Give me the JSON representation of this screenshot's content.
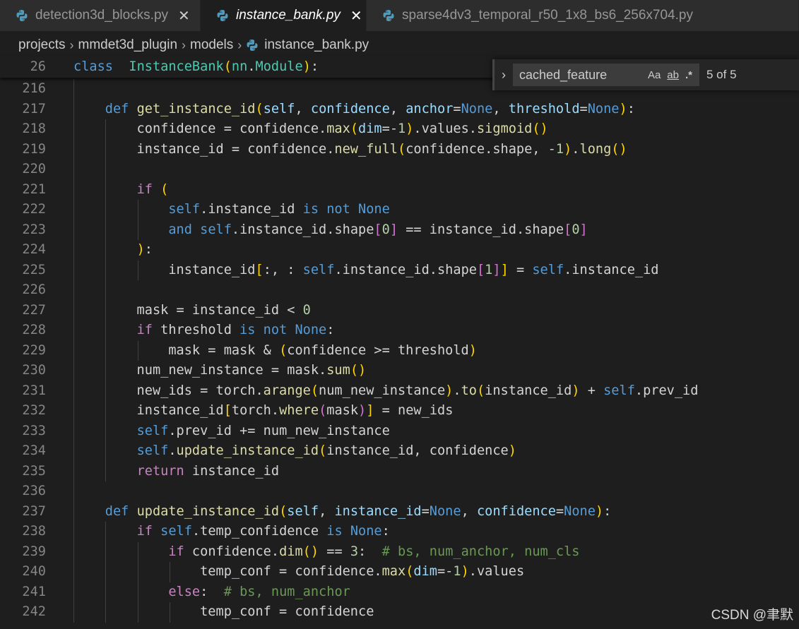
{
  "tabs": [
    {
      "label": "detection3d_blocks.py",
      "active": false,
      "close": "✕"
    },
    {
      "label": "instance_bank.py",
      "active": true,
      "close": "✕"
    },
    {
      "label": "sparse4dv3_temporal_r50_1x8_bs6_256x704.py",
      "active": false,
      "close": ""
    }
  ],
  "breadcrumb": {
    "items": [
      "projects",
      "mmdet3d_plugin",
      "models"
    ],
    "file": "instance_bank.py",
    "separator": "›"
  },
  "find": {
    "toggle": "›",
    "value": "cached_feature",
    "match_case": "Aa",
    "whole_word": "ab",
    "regex": ".*",
    "count": "5 of 5"
  },
  "colors": {
    "background": "#1e1e1e",
    "keyword": "#569cd6",
    "control": "#c586c0",
    "function": "#dcdcaa",
    "class": "#4ec9b0",
    "param": "#9cdcfe",
    "number": "#b5cea8",
    "comment": "#6a9955"
  },
  "sticky_line": {
    "num": "26",
    "tokens": [
      [
        "kw",
        "class"
      ],
      [
        "",
        "  "
      ],
      [
        "cl",
        "InstanceBank"
      ],
      [
        "b1",
        "("
      ],
      [
        "cl",
        "nn"
      ],
      [
        "",
        ".",
        ""
      ],
      [
        "cl",
        "Module"
      ],
      [
        "b1",
        ")"
      ],
      [
        "",
        ":"
      ]
    ]
  },
  "code_lines": [
    {
      "num": "216",
      "guides": [
        0
      ],
      "tokens": []
    },
    {
      "num": "217",
      "guides": [
        0
      ],
      "tokens": [
        [
          "",
          "    "
        ],
        [
          "kw",
          "def"
        ],
        [
          "",
          " "
        ],
        [
          "fn",
          "get_instance_id"
        ],
        [
          "b1",
          "("
        ],
        [
          "pm",
          "self"
        ],
        [
          "",
          ", "
        ],
        [
          "pm",
          "confidence"
        ],
        [
          "",
          ", "
        ],
        [
          "pm",
          "anchor"
        ],
        [
          "",
          "="
        ],
        [
          "kw",
          "None"
        ],
        [
          "",
          ", "
        ],
        [
          "pm",
          "threshold"
        ],
        [
          "",
          "="
        ],
        [
          "kw",
          "None"
        ],
        [
          "b1",
          ")"
        ],
        [
          "",
          ":"
        ]
      ]
    },
    {
      "num": "218",
      "guides": [
        0,
        1
      ],
      "tokens": [
        [
          "",
          "        confidence = confidence."
        ],
        [
          "fn",
          "max"
        ],
        [
          "b1",
          "("
        ],
        [
          "pm",
          "dim"
        ],
        [
          "",
          "=-"
        ],
        [
          "num",
          "1"
        ],
        [
          "b1",
          ")"
        ],
        [
          "",
          ".values."
        ],
        [
          "fn",
          "sigmoid"
        ],
        [
          "b1",
          "()"
        ]
      ]
    },
    {
      "num": "219",
      "guides": [
        0,
        1
      ],
      "tokens": [
        [
          "",
          "        instance_id = confidence."
        ],
        [
          "fn",
          "new_full"
        ],
        [
          "b1",
          "("
        ],
        [
          "",
          "confidence.shape, -"
        ],
        [
          "num",
          "1"
        ],
        [
          "b1",
          ")"
        ],
        [
          "",
          "."
        ],
        [
          "fn",
          "long"
        ],
        [
          "b1",
          "()"
        ]
      ]
    },
    {
      "num": "220",
      "guides": [
        0,
        1
      ],
      "tokens": []
    },
    {
      "num": "221",
      "guides": [
        0,
        1
      ],
      "tokens": [
        [
          "",
          "        "
        ],
        [
          "ck",
          "if"
        ],
        [
          "",
          " "
        ],
        [
          "b1",
          "("
        ]
      ]
    },
    {
      "num": "222",
      "guides": [
        0,
        1,
        2
      ],
      "tokens": [
        [
          "",
          "            "
        ],
        [
          "kw",
          "self"
        ],
        [
          "",
          ".instance_id "
        ],
        [
          "kw",
          "is not None"
        ]
      ]
    },
    {
      "num": "223",
      "guides": [
        0,
        1,
        2
      ],
      "tokens": [
        [
          "",
          "            "
        ],
        [
          "kw",
          "and"
        ],
        [
          "",
          " "
        ],
        [
          "kw",
          "self"
        ],
        [
          "",
          ".instance_id.shape"
        ],
        [
          "b2",
          "["
        ],
        [
          "num",
          "0"
        ],
        [
          "b2",
          "]"
        ],
        [
          "",
          " == instance_id.shape"
        ],
        [
          "b2",
          "["
        ],
        [
          "num",
          "0"
        ],
        [
          "b2",
          "]"
        ]
      ]
    },
    {
      "num": "224",
      "guides": [
        0,
        1
      ],
      "tokens": [
        [
          "",
          "        "
        ],
        [
          "b1",
          ")"
        ],
        [
          "",
          ":"
        ]
      ]
    },
    {
      "num": "225",
      "guides": [
        0,
        1,
        2
      ],
      "tokens": [
        [
          "",
          "            instance_id"
        ],
        [
          "b1",
          "["
        ],
        [
          "",
          ":, : "
        ],
        [
          "kw",
          "self"
        ],
        [
          "",
          ".instance_id.shape"
        ],
        [
          "b2",
          "["
        ],
        [
          "num",
          "1"
        ],
        [
          "b2",
          "]"
        ],
        [
          "b1",
          "]"
        ],
        [
          "",
          " = "
        ],
        [
          "kw",
          "self"
        ],
        [
          "",
          ".instance_id"
        ]
      ]
    },
    {
      "num": "226",
      "guides": [
        0,
        1
      ],
      "tokens": []
    },
    {
      "num": "227",
      "guides": [
        0,
        1
      ],
      "tokens": [
        [
          "",
          "        mask = instance_id < "
        ],
        [
          "num",
          "0"
        ]
      ]
    },
    {
      "num": "228",
      "guides": [
        0,
        1
      ],
      "tokens": [
        [
          "",
          "        "
        ],
        [
          "ck",
          "if"
        ],
        [
          "",
          " threshold "
        ],
        [
          "kw",
          "is not None"
        ],
        [
          "",
          ":"
        ]
      ]
    },
    {
      "num": "229",
      "guides": [
        0,
        1,
        2
      ],
      "tokens": [
        [
          "",
          "            mask = mask & "
        ],
        [
          "b1",
          "("
        ],
        [
          "",
          "confidence >= threshold"
        ],
        [
          "b1",
          ")"
        ]
      ]
    },
    {
      "num": "230",
      "guides": [
        0,
        1
      ],
      "tokens": [
        [
          "",
          "        num_new_instance = mask."
        ],
        [
          "fn",
          "sum"
        ],
        [
          "b1",
          "()"
        ]
      ]
    },
    {
      "num": "231",
      "guides": [
        0,
        1
      ],
      "tokens": [
        [
          "",
          "        new_ids = torch."
        ],
        [
          "fn",
          "arange"
        ],
        [
          "b1",
          "("
        ],
        [
          "",
          "num_new_instance"
        ],
        [
          "b1",
          ")"
        ],
        [
          "",
          "."
        ],
        [
          "fn",
          "to"
        ],
        [
          "b1",
          "("
        ],
        [
          "",
          "instance_id"
        ],
        [
          "b1",
          ")"
        ],
        [
          "",
          " + "
        ],
        [
          "kw",
          "self"
        ],
        [
          "",
          ".prev_id"
        ]
      ]
    },
    {
      "num": "232",
      "guides": [
        0,
        1
      ],
      "tokens": [
        [
          "",
          "        instance_id"
        ],
        [
          "b1",
          "["
        ],
        [
          "",
          "torch."
        ],
        [
          "fn",
          "where"
        ],
        [
          "b2",
          "("
        ],
        [
          "",
          "mask"
        ],
        [
          "b2",
          ")"
        ],
        [
          "b1",
          "]"
        ],
        [
          "",
          " = new_ids"
        ]
      ]
    },
    {
      "num": "233",
      "guides": [
        0,
        1
      ],
      "tokens": [
        [
          "",
          "        "
        ],
        [
          "kw",
          "self"
        ],
        [
          "",
          ".prev_id += num_new_instance"
        ]
      ]
    },
    {
      "num": "234",
      "guides": [
        0,
        1
      ],
      "tokens": [
        [
          "",
          "        "
        ],
        [
          "kw",
          "self"
        ],
        [
          "",
          "."
        ],
        [
          "fn",
          "update_instance_id"
        ],
        [
          "b1",
          "("
        ],
        [
          "",
          "instance_id, confidence"
        ],
        [
          "b1",
          ")"
        ]
      ]
    },
    {
      "num": "235",
      "guides": [
        0,
        1
      ],
      "tokens": [
        [
          "",
          "        "
        ],
        [
          "ck",
          "return"
        ],
        [
          "",
          " instance_id"
        ]
      ]
    },
    {
      "num": "236",
      "guides": [
        0
      ],
      "tokens": []
    },
    {
      "num": "237",
      "guides": [
        0
      ],
      "tokens": [
        [
          "",
          "    "
        ],
        [
          "kw",
          "def"
        ],
        [
          "",
          " "
        ],
        [
          "fn",
          "update_instance_id"
        ],
        [
          "b1",
          "("
        ],
        [
          "pm",
          "self"
        ],
        [
          "",
          ", "
        ],
        [
          "pm",
          "instance_id"
        ],
        [
          "",
          "="
        ],
        [
          "kw",
          "None"
        ],
        [
          "",
          ", "
        ],
        [
          "pm",
          "confidence"
        ],
        [
          "",
          "="
        ],
        [
          "kw",
          "None"
        ],
        [
          "b1",
          ")"
        ],
        [
          "",
          ":"
        ]
      ]
    },
    {
      "num": "238",
      "guides": [
        0,
        1
      ],
      "tokens": [
        [
          "",
          "        "
        ],
        [
          "ck",
          "if"
        ],
        [
          "",
          " "
        ],
        [
          "kw",
          "self"
        ],
        [
          "",
          ".temp_confidence "
        ],
        [
          "kw",
          "is None"
        ],
        [
          "",
          ":"
        ]
      ]
    },
    {
      "num": "239",
      "guides": [
        0,
        1,
        2
      ],
      "tokens": [
        [
          "",
          "            "
        ],
        [
          "ck",
          "if"
        ],
        [
          "",
          " confidence."
        ],
        [
          "fn",
          "dim"
        ],
        [
          "b1",
          "()"
        ],
        [
          "",
          " == "
        ],
        [
          "num",
          "3"
        ],
        [
          "",
          ":  "
        ],
        [
          "cm",
          "# bs, num_anchor, num_cls"
        ]
      ]
    },
    {
      "num": "240",
      "guides": [
        0,
        1,
        2,
        3
      ],
      "tokens": [
        [
          "",
          "                temp_conf = confidence."
        ],
        [
          "fn",
          "max"
        ],
        [
          "b1",
          "("
        ],
        [
          "pm",
          "dim"
        ],
        [
          "",
          "=-"
        ],
        [
          "num",
          "1"
        ],
        [
          "b1",
          ")"
        ],
        [
          "",
          ".values"
        ]
      ]
    },
    {
      "num": "241",
      "guides": [
        0,
        1,
        2
      ],
      "tokens": [
        [
          "",
          "            "
        ],
        [
          "ck",
          "else"
        ],
        [
          "",
          ":  "
        ],
        [
          "cm",
          "# bs, num_anchor"
        ]
      ]
    },
    {
      "num": "242",
      "guides": [
        0,
        1,
        2,
        3
      ],
      "tokens": [
        [
          "",
          "                temp_conf = confidence"
        ]
      ]
    }
  ],
  "watermark": "CSDN @聿默"
}
